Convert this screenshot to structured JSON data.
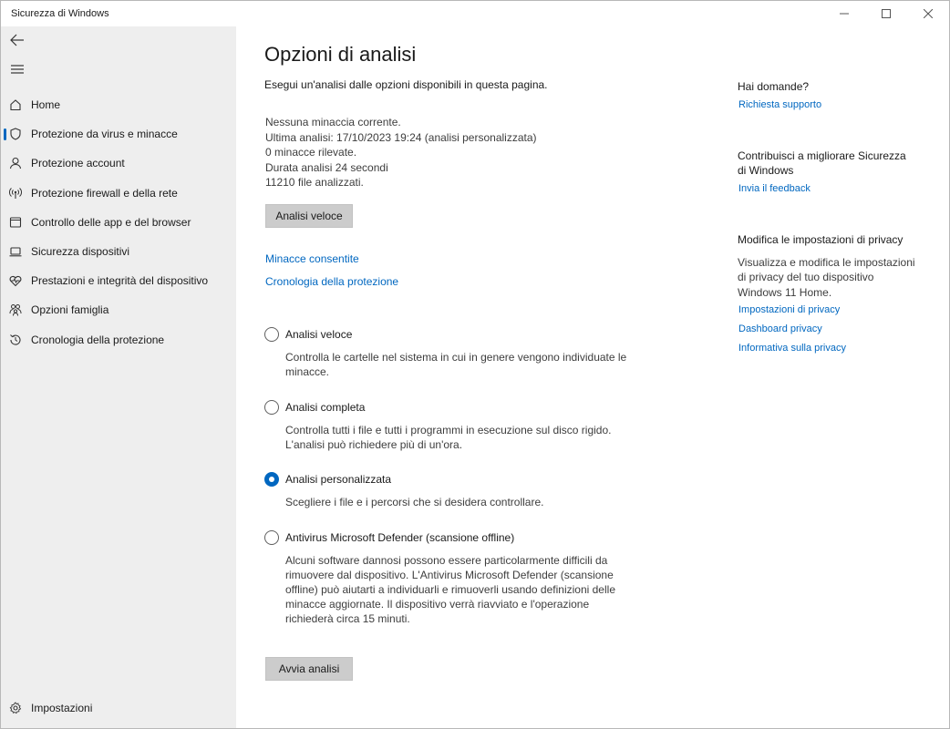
{
  "window": {
    "title": "Sicurezza di Windows"
  },
  "sidebar": {
    "items": [
      {
        "label": "Home",
        "icon": "home-icon"
      },
      {
        "label": "Protezione da virus e minacce",
        "icon": "shield-icon"
      },
      {
        "label": "Protezione account",
        "icon": "person-icon"
      },
      {
        "label": "Protezione firewall e della rete",
        "icon": "antenna-icon"
      },
      {
        "label": "Controllo delle app e del browser",
        "icon": "app-window-icon"
      },
      {
        "label": "Sicurezza dispositivi",
        "icon": "laptop-icon"
      },
      {
        "label": "Prestazioni e integrità del dispositivo",
        "icon": "heart-pulse-icon"
      },
      {
        "label": "Opzioni famiglia",
        "icon": "family-icon"
      },
      {
        "label": "Cronologia della protezione",
        "icon": "history-icon"
      }
    ],
    "active_index": 1,
    "settings_label": "Impostazioni"
  },
  "main": {
    "title": "Opzioni di analisi",
    "subtitle": "Esegui un'analisi dalle opzioni disponibili in questa pagina.",
    "status": {
      "line1": "Nessuna minaccia corrente.",
      "line2": "Ultima analisi: 17/10/2023 19:24 (analisi personalizzata)",
      "line3": "0 minacce rilevate.",
      "line4": "Durata analisi 24 secondi",
      "line5": "11210 file analizzati."
    },
    "quick_scan_button": "Analisi veloce",
    "links": {
      "allowed_threats": "Minacce consentite",
      "protection_history": "Cronologia della protezione"
    },
    "options": [
      {
        "label": "Analisi veloce",
        "description": "Controlla le cartelle nel sistema in cui in genere vengono individuate le minacce.",
        "checked": false
      },
      {
        "label": "Analisi completa",
        "description": "Controlla tutti i file e tutti i programmi in esecuzione sul disco rigido. L'analisi può richiedere più di un'ora.",
        "checked": false
      },
      {
        "label": "Analisi personalizzata",
        "description": "Scegliere i file e i percorsi che si desidera controllare.",
        "checked": true
      },
      {
        "label": "Antivirus Microsoft Defender (scansione offline)",
        "description": "Alcuni software dannosi possono essere particolarmente difficili da rimuovere dal dispositivo. L'Antivirus Microsoft Defender (scansione offline) può aiutarti a individuarli e rimuoverli usando definizioni delle minacce aggiornate. Il dispositivo verrà riavviato e l'operazione richiederà circa 15 minuti.",
        "checked": false
      }
    ],
    "start_button": "Avvia analisi"
  },
  "aside": {
    "questions_heading": "Hai domande?",
    "support_link": "Richiesta supporto",
    "improve_heading": "Contribuisci a migliorare Sicurezza di Windows",
    "feedback_link": "Invia il feedback",
    "privacy_heading": "Modifica le impostazioni di privacy",
    "privacy_text": "Visualizza e modifica le impostazioni di privacy del tuo dispositivo Windows 11 Home.",
    "privacy_settings_link": "Impostazioni di privacy",
    "privacy_dashboard_link": "Dashboard privacy",
    "privacy_statement_link": "Informativa sulla privacy"
  },
  "colors": {
    "accent": "#0067c0",
    "sidebar_bg": "#eeeeee",
    "button_bg": "#cccccc"
  }
}
